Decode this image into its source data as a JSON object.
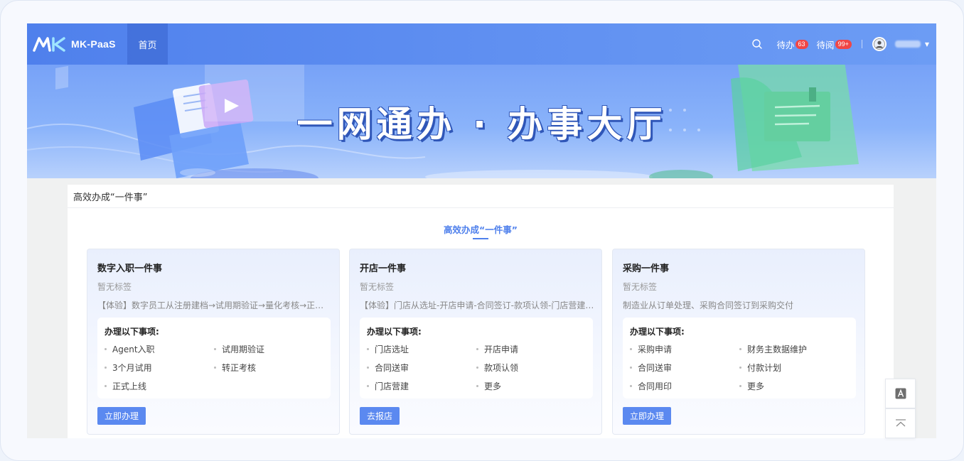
{
  "app": {
    "brand": "MK-PaaS"
  },
  "topnav": {
    "home_label": "首页",
    "todo_label": "待办",
    "todo_count": "63",
    "toread_label": "待阅",
    "toread_count": "99+"
  },
  "banner": {
    "title": "一网通办 · 办事大厅"
  },
  "panel": {
    "header": "高效办成“一件事”",
    "section_title": "高效办成“一件事”"
  },
  "cards": [
    {
      "title": "数字入职一件事",
      "tag": "暂无标签",
      "desc": "【体验】数字员工从注册建档→试用期验证→量化考核→正式上线",
      "items_title": "办理以下事项:",
      "items": [
        "Agent入职",
        "试用期验证",
        "3个月试用",
        "转正考核",
        "正式上线"
      ],
      "button": "立即办理"
    },
    {
      "title": "开店一件事",
      "tag": "暂无标签",
      "desc": "【体验】门店从选址-开店申请-合同签订-款项认领-门店营建-开业",
      "items_title": "办理以下事项:",
      "items": [
        "门店选址",
        "开店申请",
        "合同送审",
        "款项认领",
        "门店营建",
        "更多"
      ],
      "button": "去报店"
    },
    {
      "title": "采购一件事",
      "tag": "暂无标签",
      "desc": "制造业从订单处理、采购合同签订到采购交付",
      "items_title": "办理以下事项:",
      "items": [
        "采购申请",
        "财务主数据维护",
        "合同送审",
        "付款计划",
        "合同用印",
        "更多"
      ],
      "button": "立即办理"
    }
  ],
  "icons": {
    "search": "search-icon",
    "avatar": "user-avatar-icon",
    "font": "font-size-icon",
    "back_to_top": "back-to-top-icon"
  },
  "colors": {
    "primary": "#4f80ec",
    "badge": "#f04646",
    "button": "#5b89f0"
  }
}
